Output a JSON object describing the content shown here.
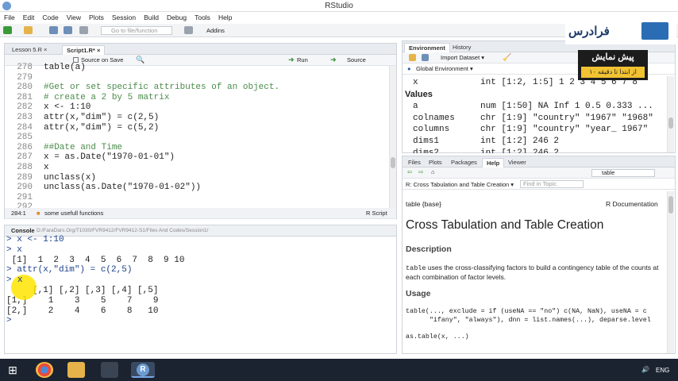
{
  "window": {
    "title": "RStudio"
  },
  "menu": [
    "File",
    "Edit",
    "Code",
    "View",
    "Plots",
    "Session",
    "Build",
    "Debug",
    "Tools",
    "Help"
  ],
  "toolbar": {
    "goto_placeholder": "Go to file/function",
    "addins": "Addins"
  },
  "editor": {
    "tabs": [
      "Lesson 5.R",
      "Script1.R*"
    ],
    "source_on_save": "Source on Save",
    "run": "Run",
    "source": "Source",
    "lines": [
      {
        "n": "278",
        "t": "table(a)",
        "c": "code"
      },
      {
        "n": "279",
        "t": "",
        "c": "code"
      },
      {
        "n": "280",
        "t": "#Get or set specific attributes of an object.",
        "c": "cm"
      },
      {
        "n": "281",
        "t": "# create a 2 by 5 matrix",
        "c": "cm"
      },
      {
        "n": "282",
        "t": "x <- 1:10",
        "c": "code"
      },
      {
        "n": "283",
        "t": "attr(x,\"dim\") = c(2,5)",
        "c": "code"
      },
      {
        "n": "284",
        "t": "attr(x,\"dim\") = c(5,2)",
        "c": "code"
      },
      {
        "n": "285",
        "t": "",
        "c": "code"
      },
      {
        "n": "286",
        "t": "##Date and Time",
        "c": "cm"
      },
      {
        "n": "287",
        "t": "x = as.Date(\"1970-01-01\")",
        "c": "code"
      },
      {
        "n": "288",
        "t": "x",
        "c": "code"
      },
      {
        "n": "289",
        "t": "unclass(x)",
        "c": "code"
      },
      {
        "n": "290",
        "t": "unclass(as.Date(\"1970-01-02\"))",
        "c": "code"
      },
      {
        "n": "291",
        "t": "",
        "c": "code"
      },
      {
        "n": "292",
        "t": "",
        "c": "code"
      }
    ],
    "status_pos": "284:1",
    "status_section": "some usefull functions",
    "status_lang": "R Script"
  },
  "console": {
    "title": "Console",
    "path": "D:/FaraDars.Org/T1030/FVR9412/FVR9412-S1/Files And Codes/Session1/",
    "lines": [
      {
        "t": "> x <- 1:10",
        "k": "in"
      },
      {
        "t": "> x",
        "k": "in"
      },
      {
        "t": " [1]  1  2  3  4  5  6  7  8  9 10",
        "k": "out"
      },
      {
        "t": "> attr(x,\"dim\") = c(2,5)",
        "k": "in"
      },
      {
        "t": "> x",
        "k": "in"
      },
      {
        "t": "     [,1] [,2] [,3] [,4] [,5]",
        "k": "out"
      },
      {
        "t": "[1,]    1    3    5    7    9",
        "k": "out"
      },
      {
        "t": "[2,]    2    4    6    8   10",
        "k": "out"
      },
      {
        "t": ">",
        "k": "in"
      }
    ]
  },
  "environment": {
    "tabs": [
      "Environment",
      "History"
    ],
    "import": "Import Dataset",
    "scope": "Global Environment",
    "top_row": {
      "n": "x",
      "v": "int [1:2, 1:5] 1 2 3 4 5 6 7 8"
    },
    "values_header": "Values",
    "rows": [
      {
        "n": "a",
        "v": "num [1:50] NA Inf 1 0.5 0.333 ..."
      },
      {
        "n": "colnames",
        "v": "chr [1:9] \"country\" \"1967\" \"1968\""
      },
      {
        "n": "columns",
        "v": "chr [1:9] \"country\" \"year_ 1967\""
      },
      {
        "n": "dims1",
        "v": "int [1:2] 246 2"
      },
      {
        "n": "dims2",
        "v": "int [1:2] 246 2"
      }
    ]
  },
  "help": {
    "tabs": [
      "Files",
      "Plots",
      "Packages",
      "Help",
      "Viewer"
    ],
    "search_value": "table",
    "topic": "R: Cross Tabulation and Table Creation",
    "find_placeholder": "Find in Topic",
    "pkg": "table {base}",
    "rdoc": "R Documentation",
    "title": "Cross Tabulation and Table Creation",
    "desc_h": "Description",
    "desc_code": "table",
    "desc": " uses the cross-classifying factors to build a contingency table of the counts at each combination of factor levels.",
    "usage_h": "Usage",
    "usage1": "table(..., exclude = if (useNA == \"no\") c(NA, NaN), useNA = c",
    "usage2": "      \"ifany\", \"always\"), dnn = list.names(...), deparse.level",
    "usage3": "as.table(x, ...)"
  },
  "overlay": {
    "brand": "فرادرس",
    "banner_title": "پیش نمایش",
    "banner_sub": "از ابتدا تا دقیقه ۱۰"
  },
  "taskbar": {
    "lang": "ENG"
  }
}
